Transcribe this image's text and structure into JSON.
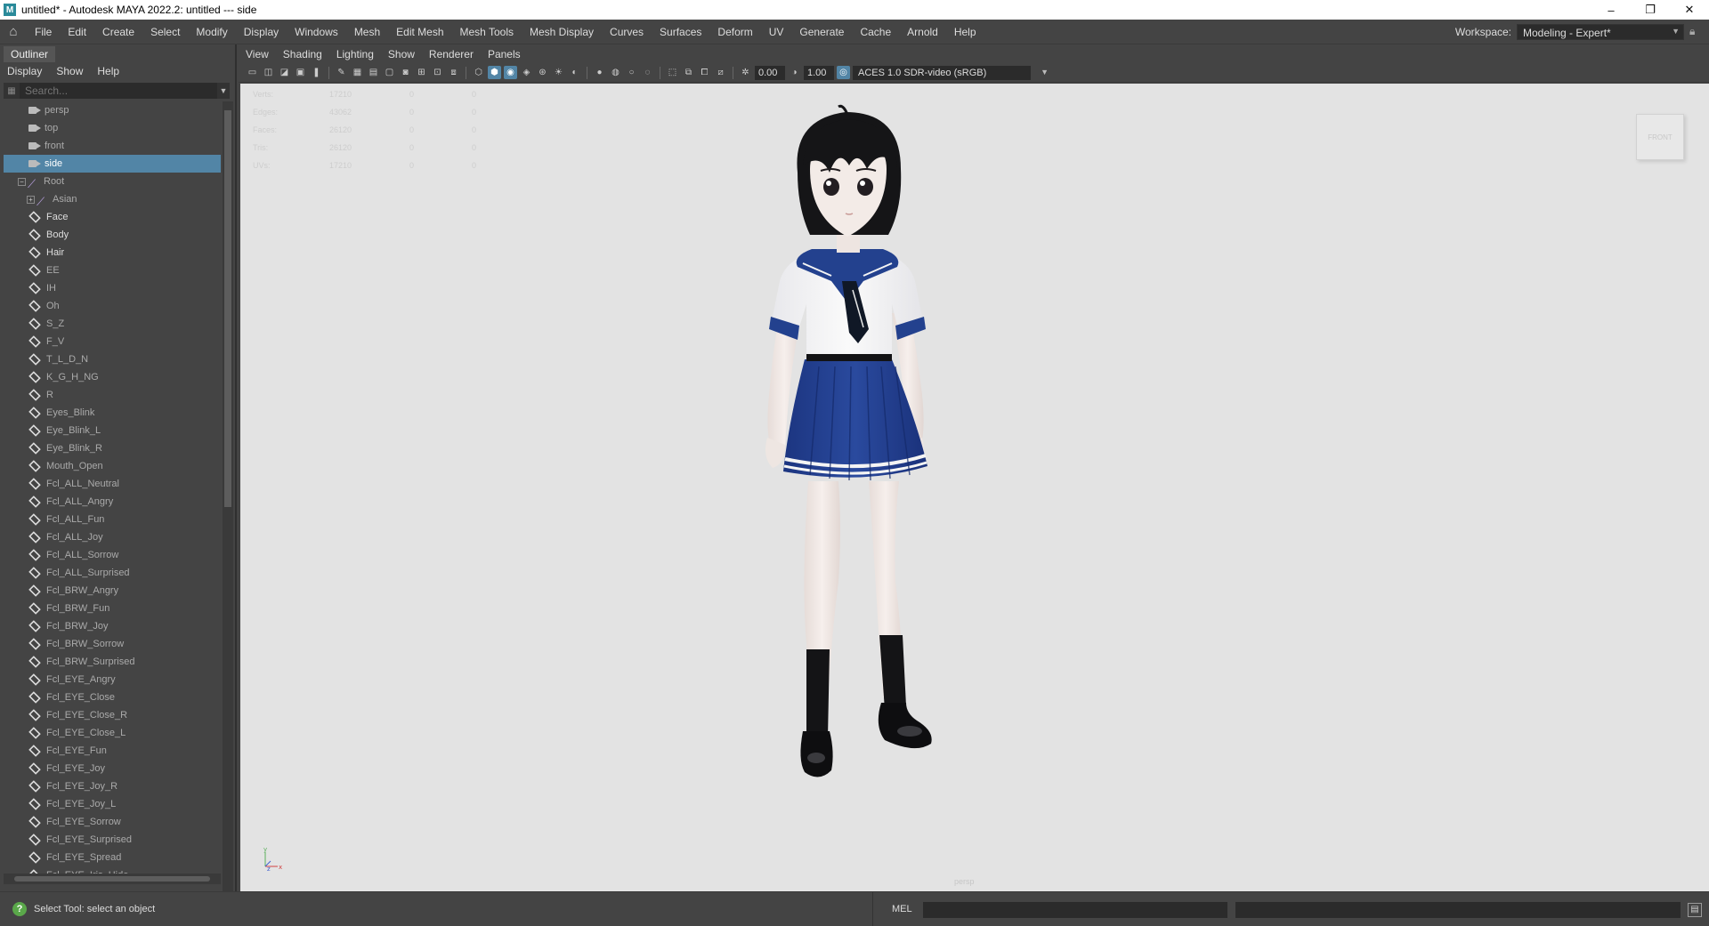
{
  "window": {
    "title": "untitled* - Autodesk MAYA 2022.2: untitled   ---  side",
    "app_icon": "M",
    "controls": [
      "–",
      "❐",
      "✕"
    ]
  },
  "menubar": {
    "items": [
      "File",
      "Edit",
      "Create",
      "Select",
      "Modify",
      "Display",
      "Windows",
      "Mesh",
      "Edit Mesh",
      "Mesh Tools",
      "Mesh Display",
      "Curves",
      "Surfaces",
      "Deform",
      "UV",
      "Generate",
      "Cache",
      "Arnold",
      "Help"
    ],
    "workspace_label": "Workspace:",
    "workspace_value": "Modeling - Expert*"
  },
  "outliner": {
    "tab": "Outliner",
    "menu": [
      "Display",
      "Show",
      "Help"
    ],
    "search_placeholder": "Search...",
    "items": [
      {
        "label": "persp",
        "icon": "camera-icon",
        "kind": "camera"
      },
      {
        "label": "top",
        "icon": "camera-icon",
        "kind": "camera"
      },
      {
        "label": "front",
        "icon": "camera-icon",
        "kind": "camera"
      },
      {
        "label": "side",
        "icon": "camera-icon",
        "kind": "camera",
        "selected": true
      },
      {
        "label": "Root",
        "icon": "joint-icon",
        "kind": "joint",
        "expander": "−"
      },
      {
        "label": "Asian",
        "icon": "joint-icon",
        "kind": "joint",
        "expander": "+",
        "indent": 1
      },
      {
        "label": "Face",
        "icon": "mesh-icon",
        "kind": "mesh",
        "bright": true
      },
      {
        "label": "Body",
        "icon": "mesh-icon",
        "kind": "mesh",
        "bright": true
      },
      {
        "label": "Hair",
        "icon": "mesh-icon",
        "kind": "mesh",
        "bright": true
      },
      {
        "label": "EE",
        "icon": "mesh-icon",
        "kind": "mesh"
      },
      {
        "label": "IH",
        "icon": "mesh-icon",
        "kind": "mesh"
      },
      {
        "label": "Oh",
        "icon": "mesh-icon",
        "kind": "mesh"
      },
      {
        "label": "S_Z",
        "icon": "mesh-icon",
        "kind": "mesh"
      },
      {
        "label": "F_V",
        "icon": "mesh-icon",
        "kind": "mesh"
      },
      {
        "label": "T_L_D_N",
        "icon": "mesh-icon",
        "kind": "mesh"
      },
      {
        "label": "K_G_H_NG",
        "icon": "mesh-icon",
        "kind": "mesh"
      },
      {
        "label": "R",
        "icon": "mesh-icon",
        "kind": "mesh"
      },
      {
        "label": "Eyes_Blink",
        "icon": "mesh-icon",
        "kind": "mesh"
      },
      {
        "label": "Eye_Blink_L",
        "icon": "mesh-icon",
        "kind": "mesh"
      },
      {
        "label": "Eye_Blink_R",
        "icon": "mesh-icon",
        "kind": "mesh"
      },
      {
        "label": "Mouth_Open",
        "icon": "mesh-icon",
        "kind": "mesh"
      },
      {
        "label": "Fcl_ALL_Neutral",
        "icon": "mesh-icon",
        "kind": "mesh"
      },
      {
        "label": "Fcl_ALL_Angry",
        "icon": "mesh-icon",
        "kind": "mesh"
      },
      {
        "label": "Fcl_ALL_Fun",
        "icon": "mesh-icon",
        "kind": "mesh"
      },
      {
        "label": "Fcl_ALL_Joy",
        "icon": "mesh-icon",
        "kind": "mesh"
      },
      {
        "label": "Fcl_ALL_Sorrow",
        "icon": "mesh-icon",
        "kind": "mesh"
      },
      {
        "label": "Fcl_ALL_Surprised",
        "icon": "mesh-icon",
        "kind": "mesh"
      },
      {
        "label": "Fcl_BRW_Angry",
        "icon": "mesh-icon",
        "kind": "mesh"
      },
      {
        "label": "Fcl_BRW_Fun",
        "icon": "mesh-icon",
        "kind": "mesh"
      },
      {
        "label": "Fcl_BRW_Joy",
        "icon": "mesh-icon",
        "kind": "mesh"
      },
      {
        "label": "Fcl_BRW_Sorrow",
        "icon": "mesh-icon",
        "kind": "mesh"
      },
      {
        "label": "Fcl_BRW_Surprised",
        "icon": "mesh-icon",
        "kind": "mesh"
      },
      {
        "label": "Fcl_EYE_Angry",
        "icon": "mesh-icon",
        "kind": "mesh"
      },
      {
        "label": "Fcl_EYE_Close",
        "icon": "mesh-icon",
        "kind": "mesh"
      },
      {
        "label": "Fcl_EYE_Close_R",
        "icon": "mesh-icon",
        "kind": "mesh"
      },
      {
        "label": "Fcl_EYE_Close_L",
        "icon": "mesh-icon",
        "kind": "mesh"
      },
      {
        "label": "Fcl_EYE_Fun",
        "icon": "mesh-icon",
        "kind": "mesh"
      },
      {
        "label": "Fcl_EYE_Joy",
        "icon": "mesh-icon",
        "kind": "mesh"
      },
      {
        "label": "Fcl_EYE_Joy_R",
        "icon": "mesh-icon",
        "kind": "mesh"
      },
      {
        "label": "Fcl_EYE_Joy_L",
        "icon": "mesh-icon",
        "kind": "mesh"
      },
      {
        "label": "Fcl_EYE_Sorrow",
        "icon": "mesh-icon",
        "kind": "mesh"
      },
      {
        "label": "Fcl_EYE_Surprised",
        "icon": "mesh-icon",
        "kind": "mesh"
      },
      {
        "label": "Fcl_EYE_Spread",
        "icon": "mesh-icon",
        "kind": "mesh"
      },
      {
        "label": "Fcl_EYE_Iris_Hide",
        "icon": "mesh-icon",
        "kind": "mesh"
      }
    ]
  },
  "viewport": {
    "menu": [
      "View",
      "Shading",
      "Lighting",
      "Show",
      "Renderer",
      "Panels"
    ],
    "exposure": "0.00",
    "gamma": "1.00",
    "color_transform": "ACES 1.0 SDR-video (sRGB)",
    "hud": [
      {
        "label": "Verts:",
        "v1": "17210",
        "v2": "0",
        "v3": "0"
      },
      {
        "label": "Edges:",
        "v1": "43062",
        "v2": "0",
        "v3": "0"
      },
      {
        "label": "Faces:",
        "v1": "26120",
        "v2": "0",
        "v3": "0"
      },
      {
        "label": "Tris:",
        "v1": "26120",
        "v2": "0",
        "v3": "0"
      },
      {
        "label": "UVs:",
        "v1": "17210",
        "v2": "0",
        "v3": "0"
      }
    ],
    "viewcube_label": "FRONT",
    "camera_label": "persp",
    "axis_y": "y",
    "axis_x": "x",
    "axis_z": "z",
    "colors": {
      "uniform_blue": "#23418e",
      "uniform_white": "#f4f4f4",
      "skin": "#f0e6e2",
      "hair": "#151517",
      "background": "#e3e3e3"
    }
  },
  "statusbar": {
    "help_text": "Select Tool: select an object",
    "mel_label": "MEL",
    "help_icon": "?"
  }
}
